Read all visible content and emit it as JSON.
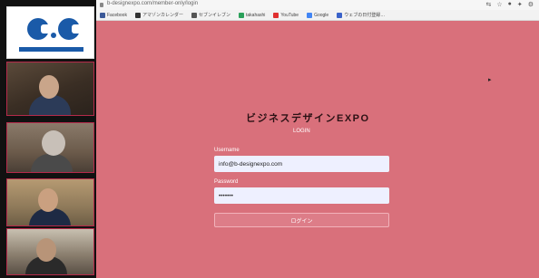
{
  "sidebar": {
    "logo_text": "C.G"
  },
  "browser": {
    "url": "b-designexpo.com/member-only/login",
    "tools": [
      "⇆",
      "☆",
      "●",
      "✦",
      "⚙"
    ],
    "bookmarks": [
      {
        "label": "Facebook",
        "color": "#3b5998"
      },
      {
        "label": "アマゾンカレンダー",
        "color": "#333333"
      },
      {
        "label": "セブンイレブン",
        "color": "#555555"
      },
      {
        "label": "takahashi",
        "color": "#2aa05a"
      },
      {
        "label": "YouTube",
        "color": "#e03030"
      },
      {
        "label": "Google",
        "color": "#4285f4"
      },
      {
        "label": "ウェブの日付登録…",
        "color": "#3a62c9"
      }
    ]
  },
  "login": {
    "title": "ビジネスデザインEXPO",
    "heading": "LOGIN",
    "username_label": "Username",
    "username_value": "info@b-designexpo.com",
    "password_label": "Password",
    "password_value": "•••••••",
    "submit_label": "ログイン"
  }
}
